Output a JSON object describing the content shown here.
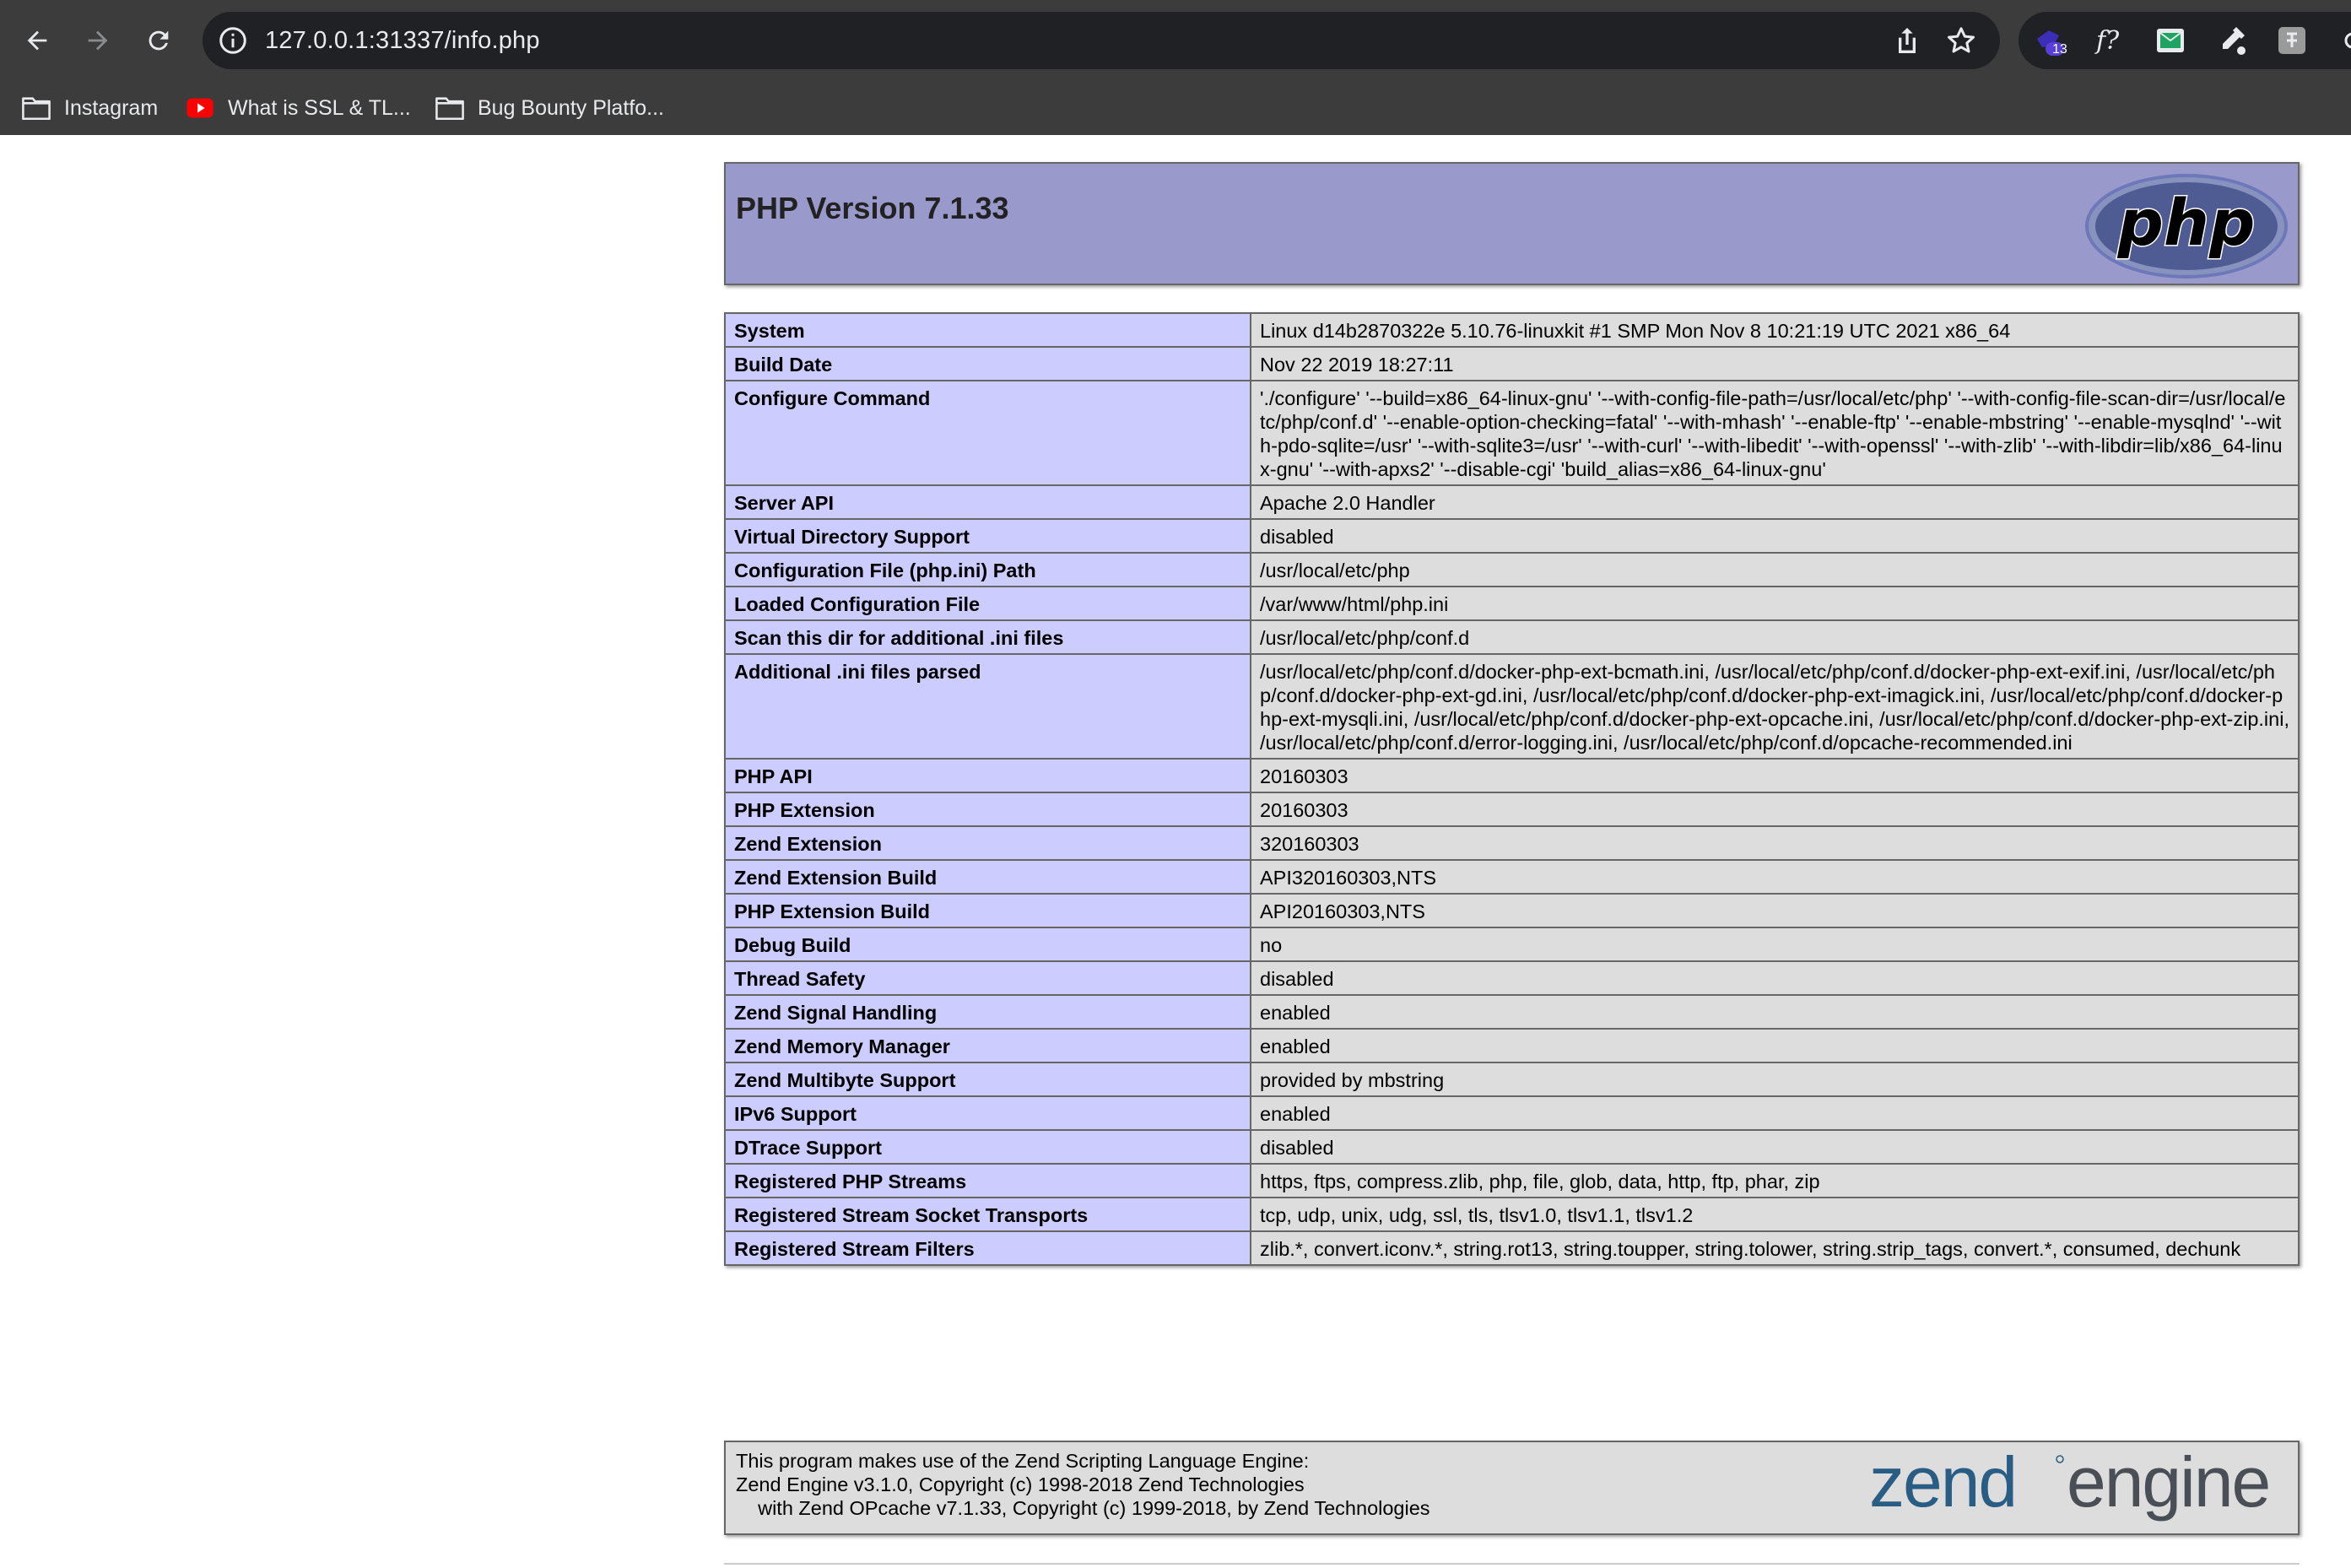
{
  "browser": {
    "url": "127.0.0.1:31337/info.php",
    "extension_badge": "13",
    "bookmarks": [
      {
        "label": "Instagram",
        "icon": "folder-icon"
      },
      {
        "label": "What is SSL & TL...",
        "icon": "youtube-icon"
      },
      {
        "label": "Bug Bounty Platfo...",
        "icon": "folder-icon"
      }
    ],
    "colors": {
      "chrome": "#3c3c3c",
      "omnibox": "#202124",
      "text": "#e8eaed"
    }
  },
  "phpinfo": {
    "title": "PHP Version 7.1.33",
    "logo_text": "php",
    "rows": [
      {
        "key": "System",
        "value": "Linux d14b2870322e 5.10.76-linuxkit #1 SMP Mon Nov 8 10:21:19 UTC 2021 x86_64"
      },
      {
        "key": "Build Date",
        "value": "Nov 22 2019 18:27:11"
      },
      {
        "key": "Configure Command",
        "value": "'./configure' '--build=x86_64-linux-gnu' '--with-config-file-path=/usr/local/etc/php' '--with-config-file-scan-dir=/usr/local/etc/php/conf.d' '--enable-option-checking=fatal' '--with-mhash' '--enable-ftp' '--enable-mbstring' '--enable-mysqlnd' '--with-pdo-sqlite=/usr' '--with-sqlite3=/usr' '--with-curl' '--with-libedit' '--with-openssl' '--with-zlib' '--with-libdir=lib/x86_64-linux-gnu' '--with-apxs2' '--disable-cgi' 'build_alias=x86_64-linux-gnu'"
      },
      {
        "key": "Server API",
        "value": "Apache 2.0 Handler"
      },
      {
        "key": "Virtual Directory Support",
        "value": "disabled"
      },
      {
        "key": "Configuration File (php.ini) Path",
        "value": "/usr/local/etc/php"
      },
      {
        "key": "Loaded Configuration File",
        "value": "/var/www/html/php.ini"
      },
      {
        "key": "Scan this dir for additional .ini files",
        "value": "/usr/local/etc/php/conf.d"
      },
      {
        "key": "Additional .ini files parsed",
        "value": "/usr/local/etc/php/conf.d/docker-php-ext-bcmath.ini, /usr/local/etc/php/conf.d/docker-php-ext-exif.ini, /usr/local/etc/php/conf.d/docker-php-ext-gd.ini, /usr/local/etc/php/conf.d/docker-php-ext-imagick.ini, /usr/local/etc/php/conf.d/docker-php-ext-mysqli.ini, /usr/local/etc/php/conf.d/docker-php-ext-opcache.ini, /usr/local/etc/php/conf.d/docker-php-ext-zip.ini, /usr/local/etc/php/conf.d/error-logging.ini, /usr/local/etc/php/conf.d/opcache-recommended.ini"
      },
      {
        "key": "PHP API",
        "value": "20160303"
      },
      {
        "key": "PHP Extension",
        "value": "20160303"
      },
      {
        "key": "Zend Extension",
        "value": "320160303"
      },
      {
        "key": "Zend Extension Build",
        "value": "API320160303,NTS"
      },
      {
        "key": "PHP Extension Build",
        "value": "API20160303,NTS"
      },
      {
        "key": "Debug Build",
        "value": "no"
      },
      {
        "key": "Thread Safety",
        "value": "disabled"
      },
      {
        "key": "Zend Signal Handling",
        "value": "enabled"
      },
      {
        "key": "Zend Memory Manager",
        "value": "enabled"
      },
      {
        "key": "Zend Multibyte Support",
        "value": "provided by mbstring"
      },
      {
        "key": "IPv6 Support",
        "value": "enabled"
      },
      {
        "key": "DTrace Support",
        "value": "disabled"
      },
      {
        "key": "Registered PHP Streams",
        "value": "https, ftps, compress.zlib, php, file, glob, data, http, ftp, phar, zip"
      },
      {
        "key": "Registered Stream Socket Transports",
        "value": "tcp, udp, unix, udg, ssl, tls, tlsv1.0, tlsv1.1, tlsv1.2"
      },
      {
        "key": "Registered Stream Filters",
        "value": "zlib.*, convert.iconv.*, string.rot13, string.toupper, string.tolower, string.strip_tags, convert.*, consumed, dechunk"
      }
    ],
    "zend": {
      "line1": "This program makes use of the Zend Scripting Language Engine:",
      "line2": "Zend Engine v3.1.0, Copyright (c) 1998-2018 Zend Technologies",
      "line3": "    with Zend OPcache v7.1.33, Copyright (c) 1999-2018, by Zend Technologies",
      "logo_text_left": "zend",
      "logo_text_right": "engine"
    },
    "colors": {
      "header": "#9999cc",
      "key_cell": "#ccccff",
      "value_cell": "#dddddd",
      "border": "#666666",
      "zend_logo": "#2a5d84"
    }
  }
}
